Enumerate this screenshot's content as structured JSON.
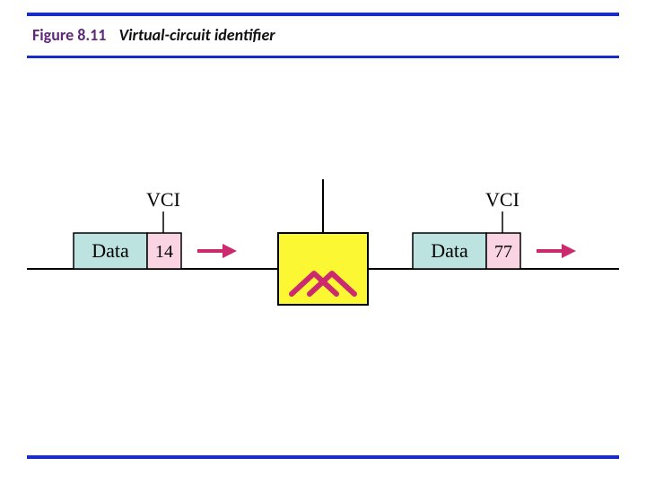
{
  "caption": {
    "figure_number": "Figure 8.11",
    "title": "Virtual-circuit identifier"
  },
  "diagram": {
    "vci_label_left": "VCI",
    "vci_label_right": "VCI",
    "packet_left": {
      "data_label": "Data",
      "vci_value": "14"
    },
    "packet_right": {
      "data_label": "Data",
      "vci_value": "77"
    },
    "colors": {
      "data_fill": "#bde3e1",
      "vci_fill": "#fbd4e4",
      "switch_fill": "#fbf733",
      "switch_symbol": "#cc2a6f",
      "arrow": "#cc2a6f",
      "line": "#000000"
    },
    "switch_semantic": "network-switch"
  }
}
